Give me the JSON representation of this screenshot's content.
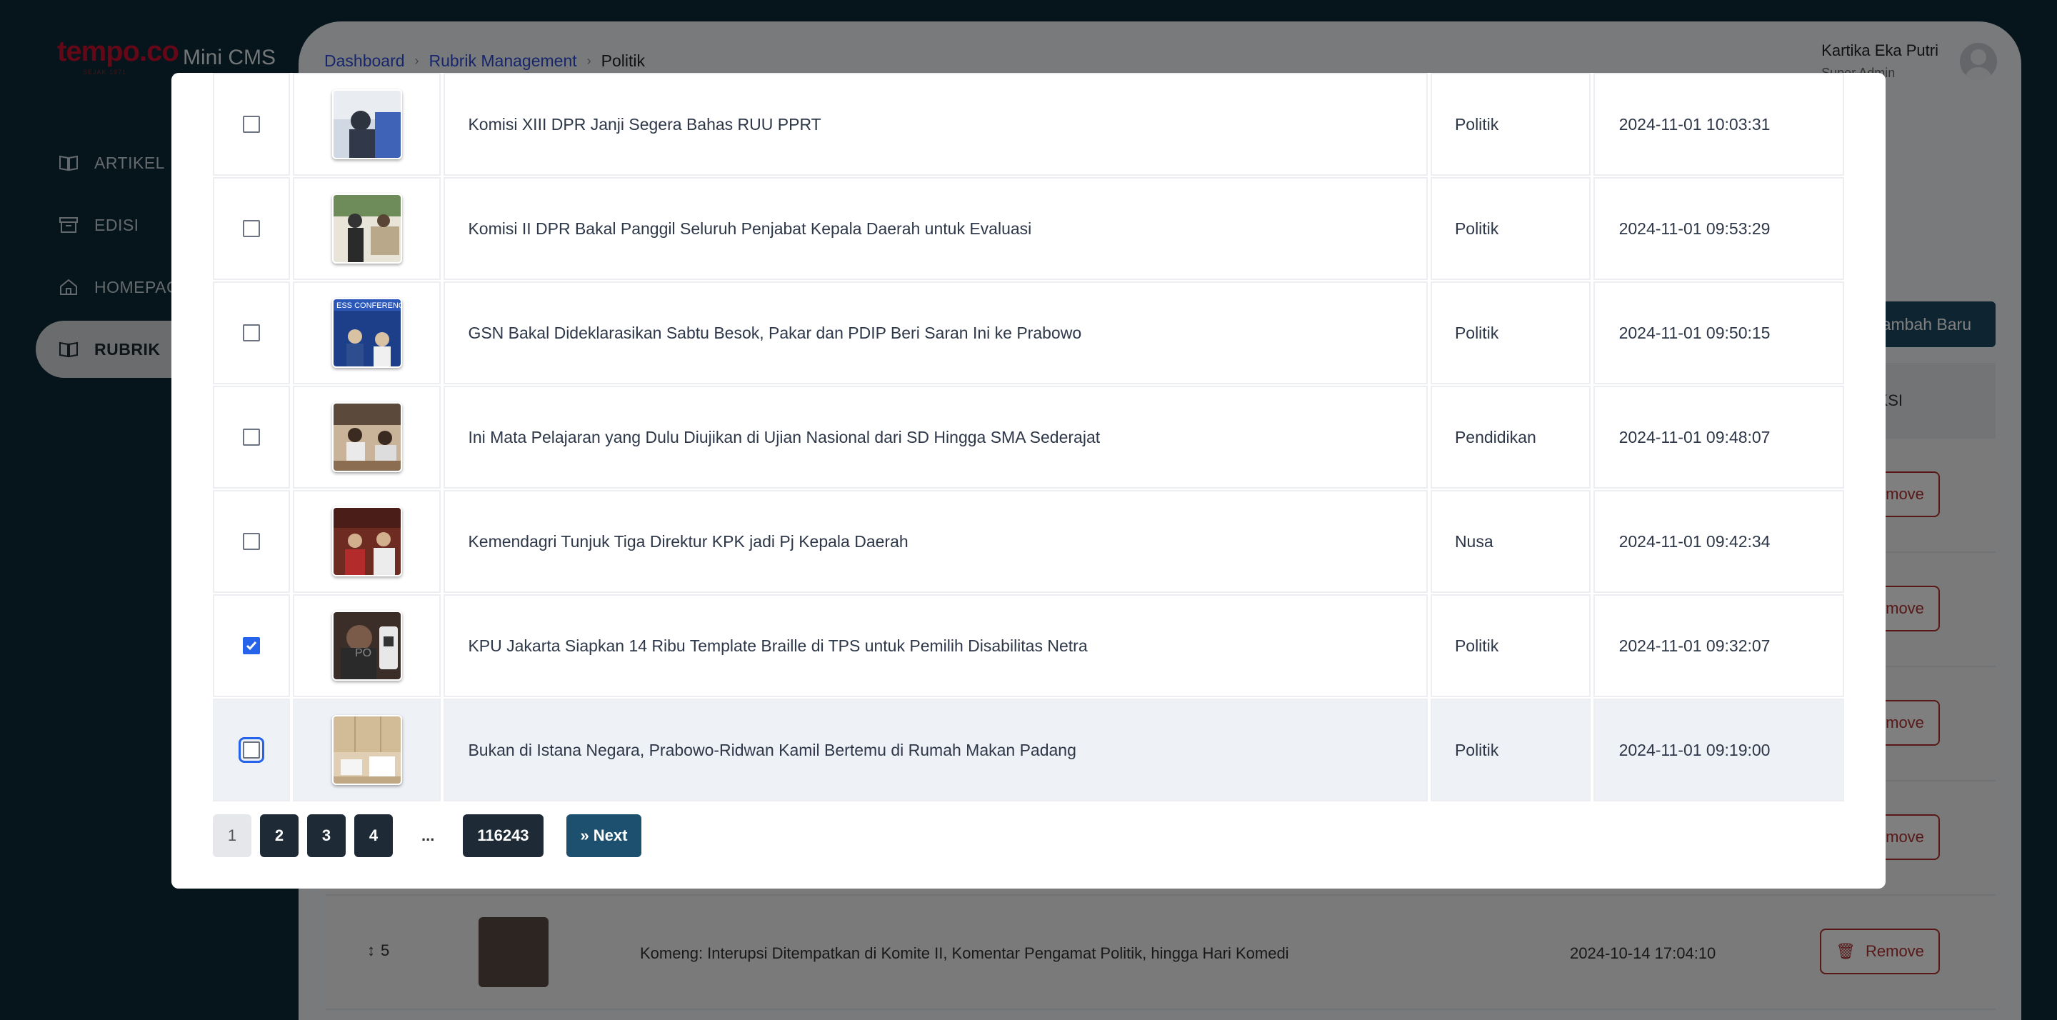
{
  "brand": {
    "logo": "tempo.co",
    "tagline": "SEJAK 1971",
    "app_name": "Mini CMS"
  },
  "sidebar": {
    "items": [
      {
        "label": "ARTIKEL",
        "icon": "book-icon"
      },
      {
        "label": "EDISI",
        "icon": "archive-icon"
      },
      {
        "label": "HOMEPAGE",
        "icon": "home-icon"
      },
      {
        "label": "RUBRIK",
        "icon": "book-icon",
        "active": true
      }
    ]
  },
  "breadcrumb": [
    "Dashboard",
    "Rubrik Management",
    "Politik"
  ],
  "user": {
    "name": "Kartika Eka Putri",
    "role": "Super Admin"
  },
  "add_button": "Tambah Baru",
  "background_table": {
    "header_action": "AKSI",
    "remove_label": "Remove",
    "visible_row": {
      "order": "5",
      "title": "Komeng: Interupsi Ditempatkan di Komite II, Komentar Pengamat Politik, hingga Hari Komedi",
      "date": "2024-10-14 17:04:10"
    }
  },
  "modal": {
    "rows": [
      {
        "title": "Komisi XIII DPR Janji Segera Bahas RUU PPRT",
        "category": "Politik",
        "date": "2024-11-01 10:03:31",
        "checked": false
      },
      {
        "title": "Komisi II DPR Bakal Panggil Seluruh Penjabat Kepala Daerah untuk Evaluasi",
        "category": "Politik",
        "date": "2024-11-01 09:53:29",
        "checked": false
      },
      {
        "title": "GSN Bakal Dideklarasikan Sabtu Besok, Pakar dan PDIP Beri Saran Ini ke Prabowo",
        "category": "Politik",
        "date": "2024-11-01 09:50:15",
        "checked": false
      },
      {
        "title": "Ini Mata Pelajaran yang Dulu Diujikan di Ujian Nasional dari SD Hingga SMA Sederajat",
        "category": "Pendidikan",
        "date": "2024-11-01 09:48:07",
        "checked": false
      },
      {
        "title": "Kemendagri Tunjuk Tiga Direktur KPK jadi Pj Kepala Daerah",
        "category": "Nusa",
        "date": "2024-11-01 09:42:34",
        "checked": false
      },
      {
        "title": "KPU Jakarta Siapkan 14 Ribu Template Braille di TPS untuk Pemilih Disabilitas Netra",
        "category": "Politik",
        "date": "2024-11-01 09:32:07",
        "checked": true
      },
      {
        "title": "Bukan di Istana Negara, Prabowo-Ridwan Kamil Bertemu di Rumah Makan Padang",
        "category": "Politik",
        "date": "2024-11-01 09:19:00",
        "checked": false,
        "focused": true
      }
    ],
    "pagination": {
      "pages": [
        "1",
        "2",
        "3",
        "4"
      ],
      "current": "1",
      "ellipsis": "...",
      "last": "116243",
      "next": "Next"
    }
  },
  "colors": {
    "accent": "#1d4f6e",
    "brand_red": "#c8102e",
    "checkbox": "#2563eb",
    "remove": "#b03030"
  }
}
